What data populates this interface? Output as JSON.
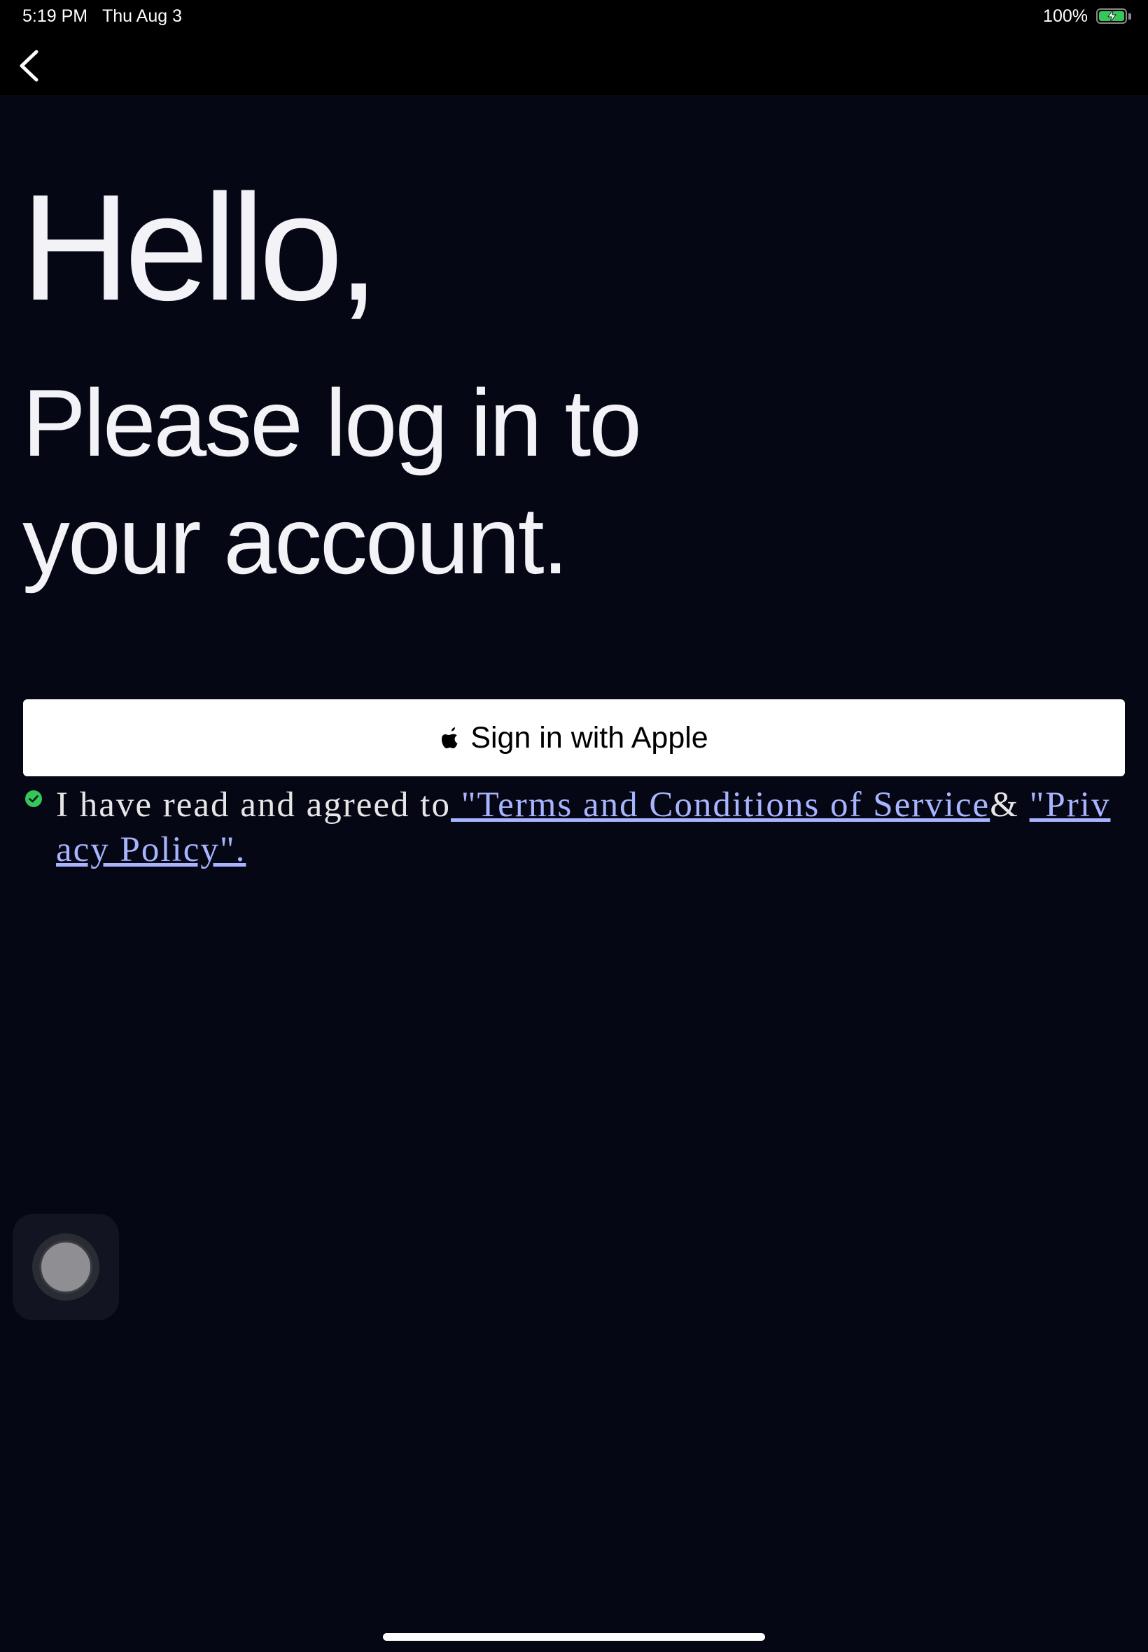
{
  "status_bar": {
    "time": "5:19 PM",
    "date": "Thu Aug 3",
    "battery_percent": "100%",
    "battery_icon": "battery-charging-icon"
  },
  "nav": {
    "back_icon": "chevron-left-icon"
  },
  "greeting": {
    "title": "Hello,",
    "subtitle": "Please log in to your account."
  },
  "sign_in_button": {
    "icon": "apple-logo-icon",
    "label": "Sign in with Apple",
    "background": "#ffffff",
    "text_color": "#000000"
  },
  "agreement": {
    "checked": true,
    "check_color": "#34c759",
    "prefix": "I have read and agreed to",
    "terms_link": " \"Terms and Conditions of Service",
    "separator": "& ",
    "privacy_link": "\"Privacy Policy\".",
    "link_color": "#a8b4ff"
  },
  "assistive_touch": {
    "icon": "assistive-touch-icon"
  },
  "colors": {
    "background": "#050814",
    "bars": "#000000",
    "text": "#f2f2f7"
  }
}
